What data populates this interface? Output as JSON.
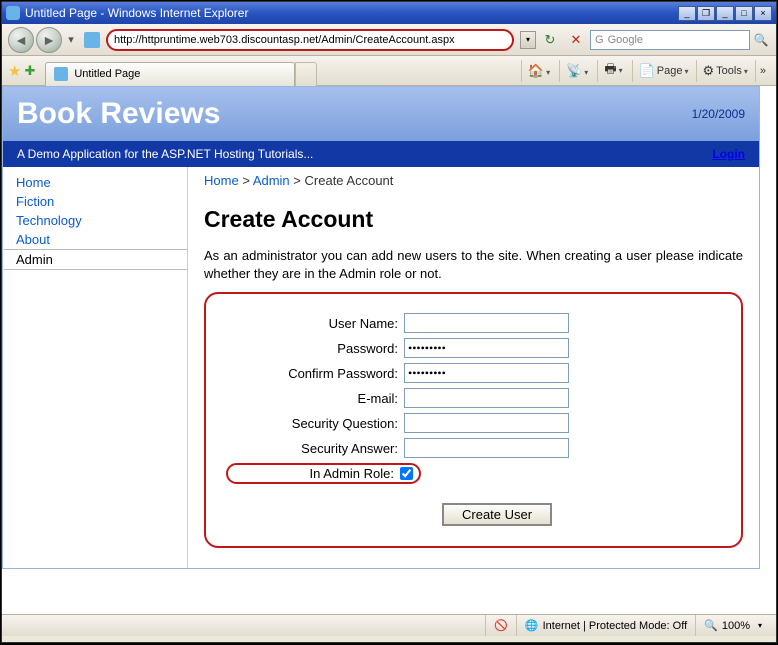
{
  "window": {
    "title": "Untitled Page - Windows Internet Explorer"
  },
  "nav": {
    "url": "http://httpruntime.web703.discountasp.net/Admin/CreateAccount.aspx",
    "search_placeholder": "Google"
  },
  "tab": {
    "label": "Untitled Page"
  },
  "toolbar": {
    "page_label": "Page",
    "tools_label": "Tools"
  },
  "header": {
    "site_title": "Book Reviews",
    "date": "1/20/2009",
    "subtitle": "A Demo Application for the ASP.NET Hosting Tutorials...",
    "login": "Login"
  },
  "sidebar": {
    "items": [
      {
        "label": "Home"
      },
      {
        "label": "Fiction"
      },
      {
        "label": "Technology"
      },
      {
        "label": "About"
      },
      {
        "label": "Admin"
      }
    ],
    "active_index": 4
  },
  "breadcrumb": {
    "home": "Home",
    "sep": ">",
    "admin": "Admin",
    "current": "Create Account"
  },
  "main": {
    "heading": "Create Account",
    "intro": "As an administrator you can add new users to the site. When creating a user please indicate whether they are in the Admin role or not.",
    "labels": {
      "username": "User Name:",
      "password": "Password:",
      "confirm": "Confirm Password:",
      "email": "E-mail:",
      "question": "Security Question:",
      "answer": "Security Answer:",
      "role": "In Admin Role:"
    },
    "values": {
      "username": "",
      "password": "•••••••••",
      "confirm": "•••••••••",
      "email": "",
      "question": "",
      "answer": "",
      "role_checked": true
    },
    "button": "Create User"
  },
  "status": {
    "mode": "Internet | Protected Mode: Off",
    "zoom": "100%"
  }
}
